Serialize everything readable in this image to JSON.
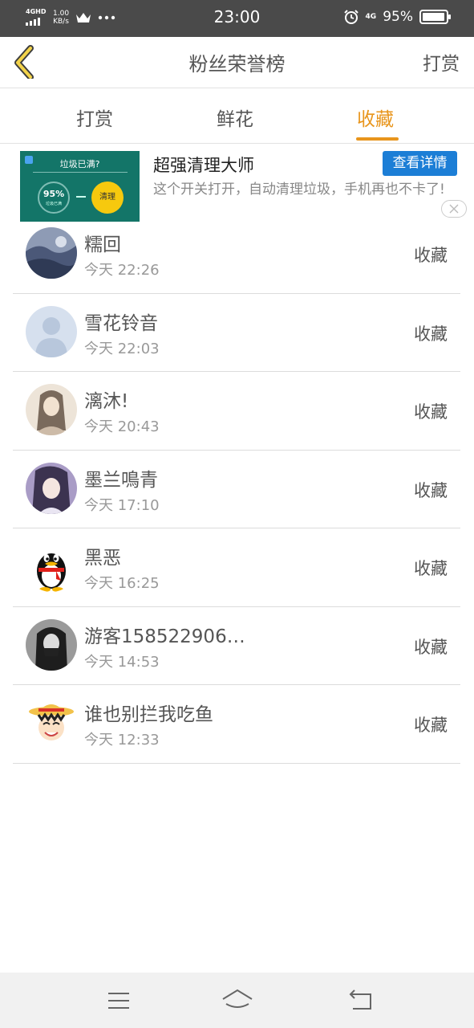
{
  "status_bar": {
    "network": "4GHD",
    "speed_value": "1.00",
    "speed_unit": "KB/s",
    "time": "23:00",
    "network_right": "4G",
    "battery": "95%",
    "battery_level": 0.95,
    "icons": [
      "signal-icon",
      "crown-icon",
      "more-dots-icon",
      "alarm-icon",
      "battery-icon"
    ]
  },
  "header": {
    "back_icon": "chevron-left-icon",
    "title": "粉丝荣誉榜",
    "action": "打赏"
  },
  "tabs": [
    {
      "label": "打赏",
      "active": false
    },
    {
      "label": "鲜花",
      "active": false
    },
    {
      "label": "收藏",
      "active": true
    }
  ],
  "ad": {
    "image_headline": "垃圾已满?",
    "image_percent": "95%",
    "image_sub": "垃圾已满",
    "image_button": "清理",
    "title": "超强清理大师",
    "button": "查看详情",
    "description": "这个开关打开，自动清理垃圾，手机再也不卡了!",
    "close_icon": "close-icon"
  },
  "accent_color": "#e8951c",
  "list": [
    {
      "name": "糯回",
      "time": "今天 22:26",
      "action": "收藏",
      "avatar": "avatar-photo-landscape"
    },
    {
      "name": "雪花铃音",
      "time": "今天 22:03",
      "action": "收藏",
      "avatar": "avatar-default"
    },
    {
      "name": "漓沐!",
      "time": "今天 20:43",
      "action": "收藏",
      "avatar": "avatar-drawing"
    },
    {
      "name": "墨兰鳴青",
      "time": "今天 17:10",
      "action": "收藏",
      "avatar": "avatar-anime"
    },
    {
      "name": "黑恶",
      "time": "今天 16:25",
      "action": "收藏",
      "avatar": "avatar-qq-penguin"
    },
    {
      "name": "游客158522906…",
      "time": "今天 14:53",
      "action": "收藏",
      "avatar": "avatar-dark-photo"
    },
    {
      "name": "谁也别拦我吃鱼",
      "time": "今天 12:33",
      "action": "收藏",
      "avatar": "avatar-cartoon-strawhat"
    }
  ],
  "nav_bar": {
    "icons": [
      "menu-icon",
      "home-icon",
      "back-icon"
    ]
  }
}
